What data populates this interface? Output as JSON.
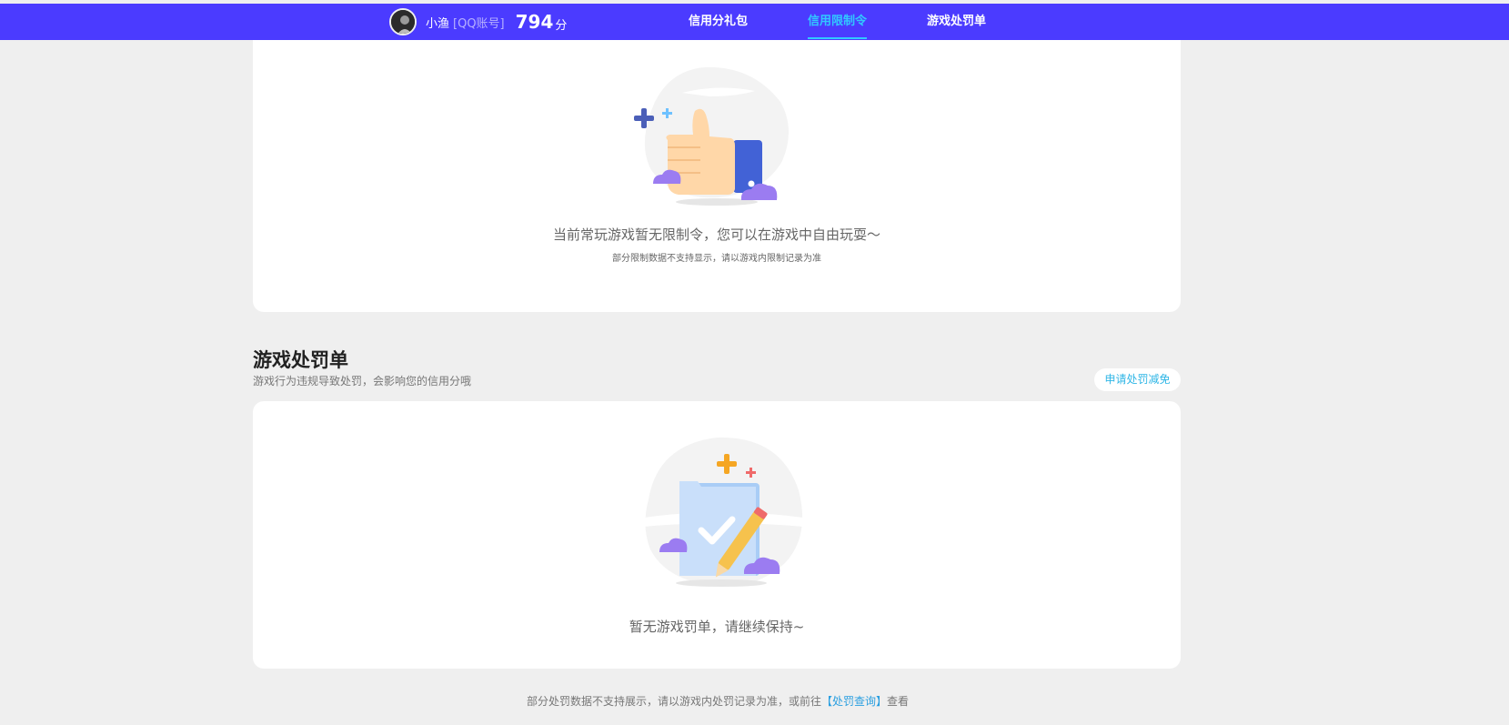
{
  "header": {
    "username": "小渔",
    "account_type": "[QQ账号]",
    "score": "794",
    "score_unit": "分",
    "nav": [
      {
        "label": "信用分礼包",
        "active": false
      },
      {
        "label": "信用限制令",
        "active": true
      },
      {
        "label": "游戏处罚单",
        "active": false
      }
    ]
  },
  "restriction": {
    "empty_title": "当前常玩游戏暂无限制令，您可以在游戏中自由玩耍～",
    "empty_note": "部分限制数据不支持显示，请以游戏内限制记录为准"
  },
  "penalty": {
    "title": "游戏处罚单",
    "description": "游戏行为违规导致处罚，会影响您的信用分哦",
    "apply_button": "申请处罚减免",
    "empty_title": "暂无游戏罚单，请继续保持~"
  },
  "footer": {
    "prefix": "部分处罚数据不支持展示，请以游戏内处罚记录为准，或前往",
    "link": "【处罚查询】",
    "suffix": "查看"
  },
  "colors": {
    "nav_bg": "#4b3bff",
    "nav_active": "#31c8ff",
    "page_bg": "#efefef",
    "link": "#2a9fe0"
  },
  "icons": {
    "avatar": "avatar-icon",
    "thumbs_up": "thumbs-up-illustration",
    "clipboard": "clipboard-check-illustration"
  }
}
